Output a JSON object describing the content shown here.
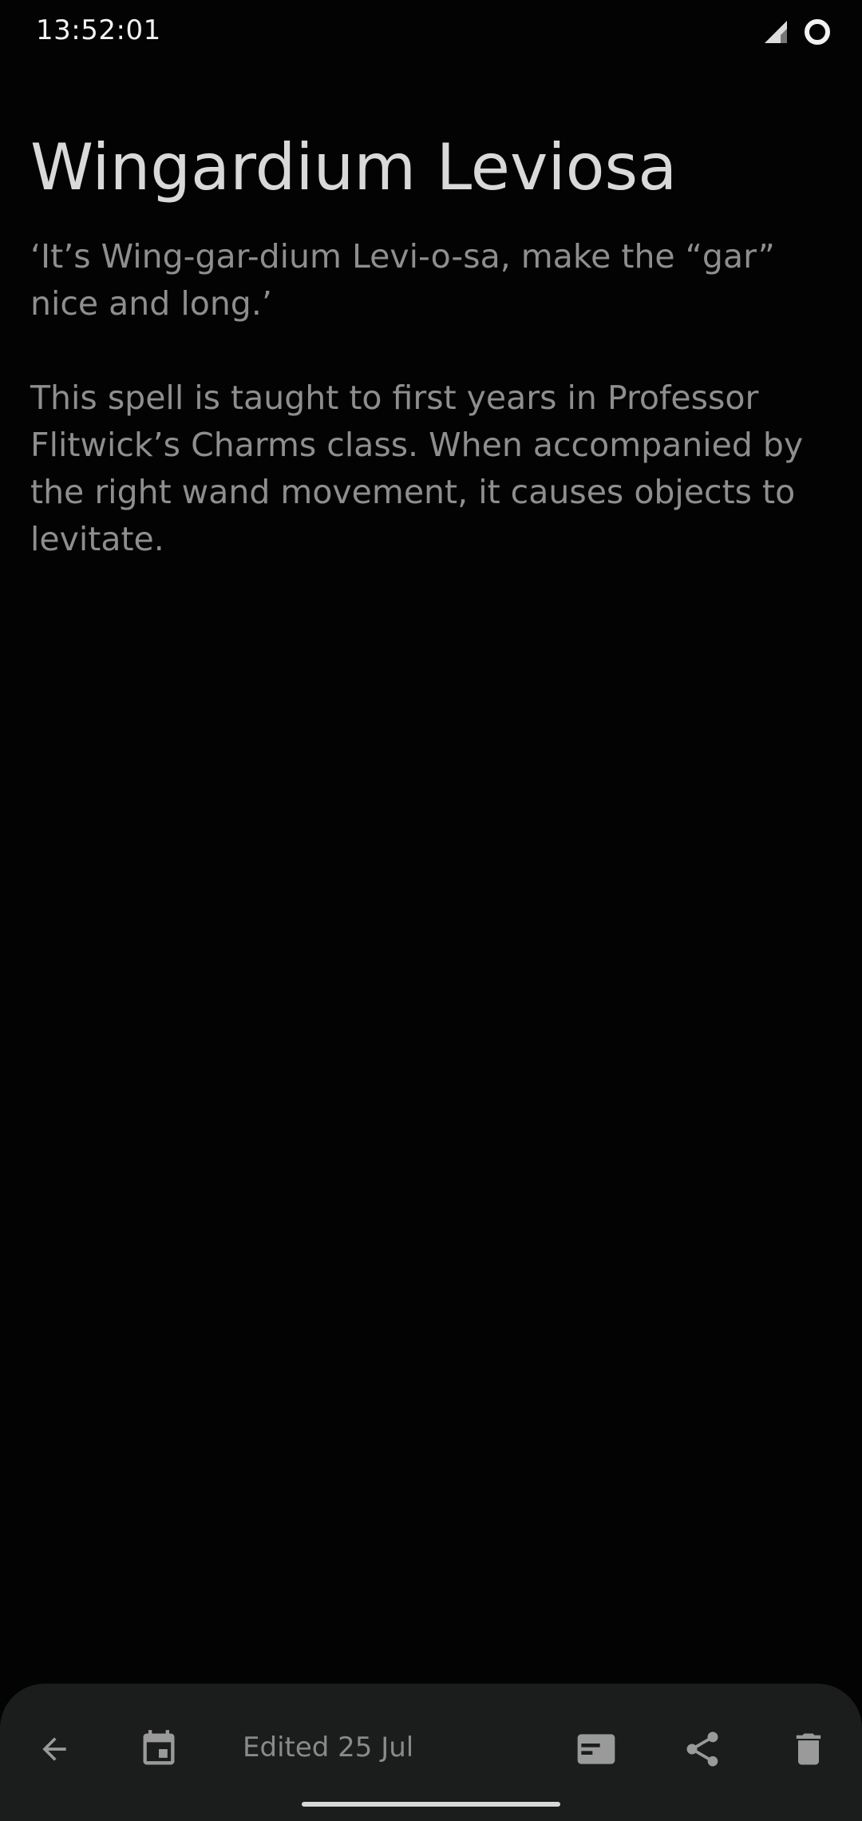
{
  "status_bar": {
    "time": "13:52:01",
    "icons": [
      "signal-icon",
      "battery-ring-icon"
    ]
  },
  "note": {
    "title": "Wingardium Leviosa",
    "body": "‘It’s Wing-gar-dium Levi-o-sa, make the “gar” nice and long.’\n\nThis spell is taught to first years in Professor Flitwick’s Charms class. When accompanied by the right wand movement, it causes objects to levitate."
  },
  "bottom_bar": {
    "edited_label": "Edited 25 Jul",
    "actions": [
      "back-arrow-icon",
      "calendar-icon",
      "reader-mode-icon",
      "share-icon",
      "delete-icon"
    ]
  },
  "colors": {
    "background": "#030303",
    "title_text": "#d9d9d9",
    "body_text": "#8e8e8e",
    "bottom_bar": "#1b1c1c",
    "icon": "#9a9a9a"
  }
}
